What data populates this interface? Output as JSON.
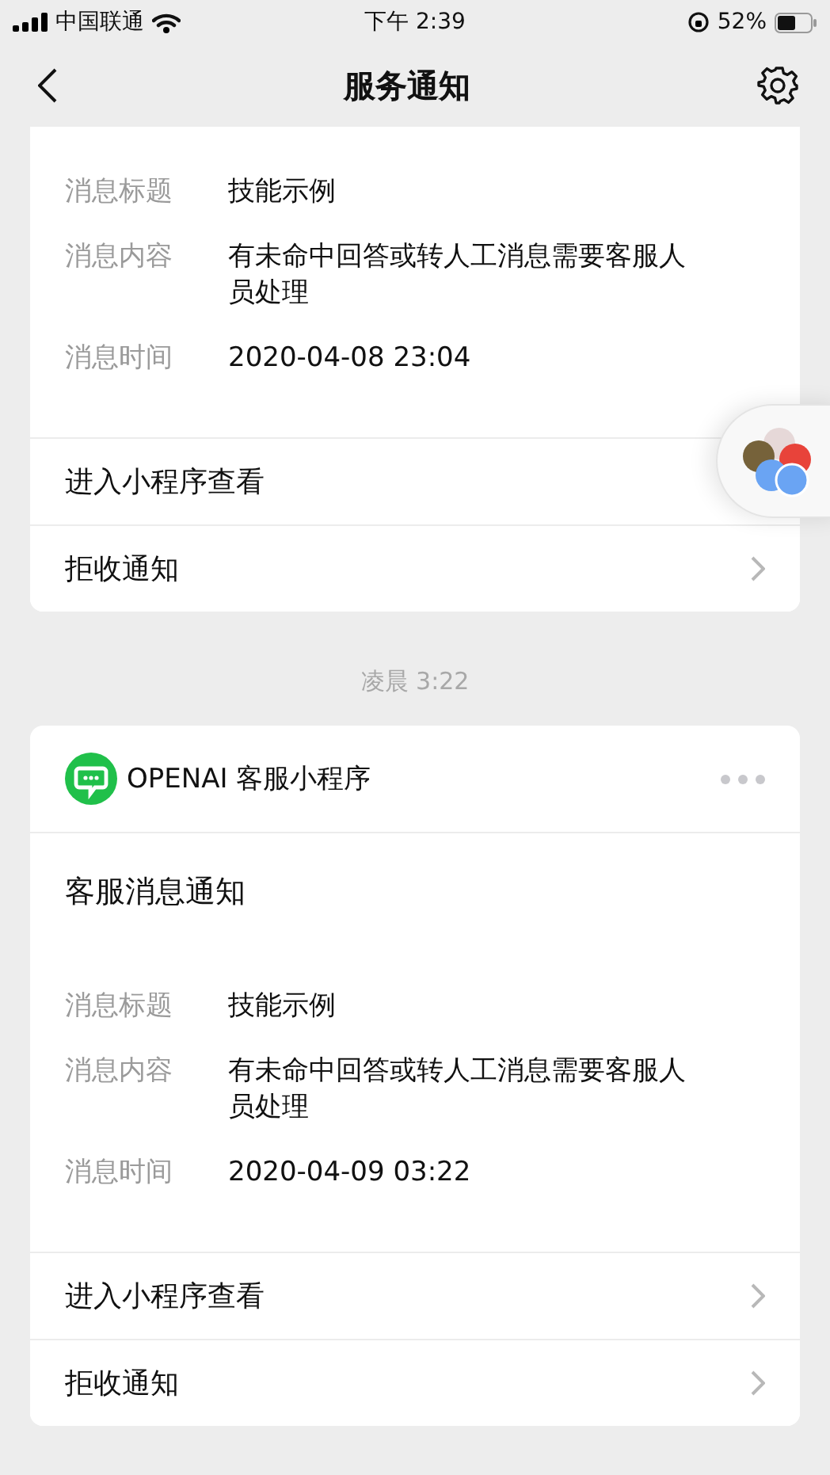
{
  "status_bar": {
    "carrier": "中国联通",
    "time": "下午 2:39",
    "battery": "52%"
  },
  "nav": {
    "title": "服务通知"
  },
  "cards": [
    {
      "fields": [
        {
          "label": "消息标题",
          "value": "技能示例"
        },
        {
          "label": "消息内容",
          "value": "有未命中回答或转人工消息需要客服人员处理"
        },
        {
          "label": "消息时间",
          "value": "2020-04-08 23:04"
        }
      ],
      "actions": [
        {
          "label": "进入小程序查看",
          "chevron": false
        },
        {
          "label": "拒收通知",
          "chevron": true
        }
      ]
    },
    {
      "timestamp": "凌晨 3:22",
      "app_name": "OPENAI 客服小程序",
      "title": "客服消息通知",
      "fields": [
        {
          "label": "消息标题",
          "value": "技能示例"
        },
        {
          "label": "消息内容",
          "value": "有未命中回答或转人工消息需要客服人员处理"
        },
        {
          "label": "消息时间",
          "value": "2020-04-09 03:22"
        }
      ],
      "actions": [
        {
          "label": "进入小程序查看",
          "chevron": true
        },
        {
          "label": "拒收通知",
          "chevron": true
        }
      ]
    }
  ]
}
